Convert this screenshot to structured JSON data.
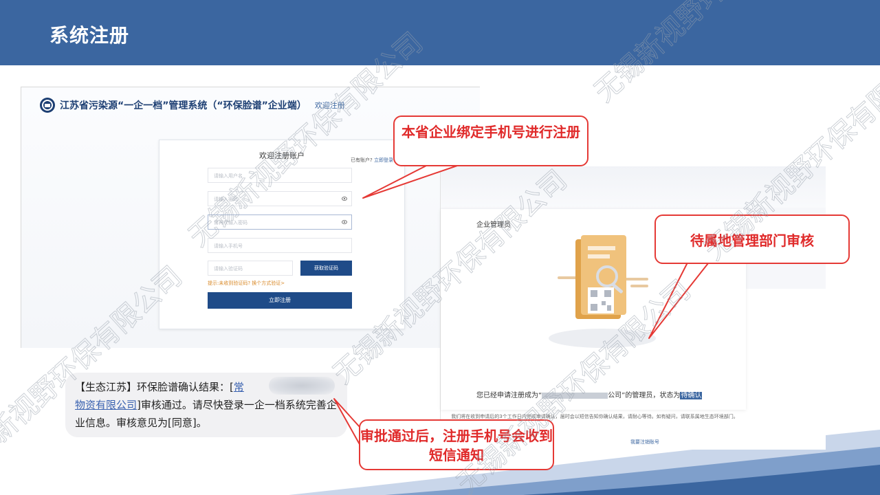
{
  "slide": {
    "title": "系统注册"
  },
  "registration": {
    "system_title": "江苏省污染源“一企一档”管理系统（“环保脸谱”企业端）",
    "welcome_label": "欢迎注册",
    "card_title": "欢迎注册账户",
    "have_account": "已有账户?",
    "login_link": "立即登录",
    "username_placeholder": "请输入用户名",
    "password_placeholder": "请输入密码",
    "confirm_placeholder": "请再次输入密码",
    "phone_placeholder": "请输入手机号",
    "code_placeholder": "请输入验证码",
    "get_code_label": "获取验证码",
    "hint": "提示:未收到验证码? 换个方式验证>",
    "submit_label": "立即注册"
  },
  "review": {
    "card_title": "企业管理员",
    "status_prefix": "您已经申请注册成为“",
    "status_middle": "公司”的管理员，状态为",
    "status_value": "待确认",
    "description": "我们将在收到申请后的3个工作日内完成审请确认，届时会以短信告知你确认结果，请耐心等待。如有疑问，请联系属地生态环境部门。",
    "cancel_link": "我要注销账号"
  },
  "sms": {
    "prefix": "【生态江苏】环保脸谱确认结果：[",
    "company_visible": "常",
    "company_tail": "物资有限公司",
    "suffix": "]审核通过。请尽快登录一企一档系统完善企业信息。审核意见为[同意]。"
  },
  "callouts": {
    "bind_phone": "本省企业绑定手机号进行注册",
    "pending": "待属地管理部门审核",
    "sms_notice": "审批通过后，注册手机号会收到短信通知"
  },
  "watermark_text": "无锡新视野环保有限公司",
  "colors": {
    "header_blue": "#3b66a0",
    "callout_red": "#e53935",
    "button_blue": "#1f4b88"
  }
}
